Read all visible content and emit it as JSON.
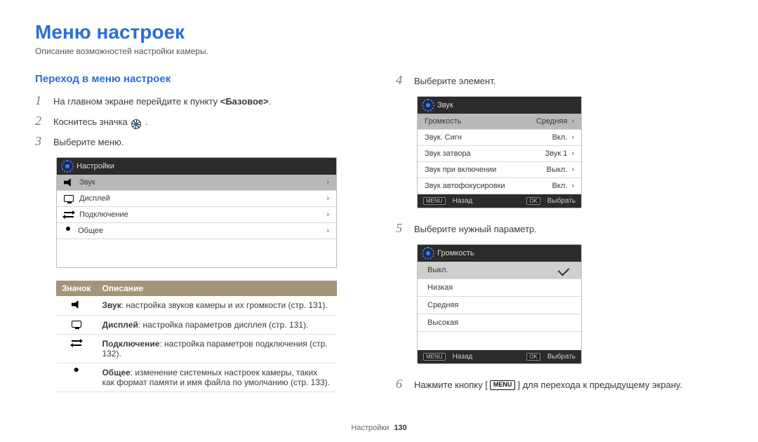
{
  "page": {
    "title": "Меню настроек",
    "subtitle": "Описание возможностей настройки камеры.",
    "footer_label": "Настройки",
    "footer_page": "130"
  },
  "section_heading": "Переход в меню настроек",
  "steps": {
    "s1_num": "1",
    "s1_pre": "На главном экране перейдите к пункту ",
    "s1_bold": "<Базовое>",
    "s1_post": ".",
    "s2_num": "2",
    "s2_pre": "Коснитесь значка",
    "s2_post": ".",
    "s3_num": "3",
    "s3_text": "Выберите меню.",
    "s4_num": "4",
    "s4_text": "Выберите элемент.",
    "s5_num": "5",
    "s5_text": "Выберите нужный параметр.",
    "s6_num": "6",
    "s6_pre": "Нажмите кнопку [",
    "s6_key": "MENU",
    "s6_post": "] для перехода к предыдущему экрану."
  },
  "settings_panel": {
    "header": "Настройки",
    "rows": [
      {
        "label": "Звук",
        "highlight": true
      },
      {
        "label": "Дисплей"
      },
      {
        "label": "Подключение"
      },
      {
        "label": "Общее"
      }
    ]
  },
  "desc_table": {
    "head_icon": "Значок",
    "head_desc": "Описание",
    "rows": [
      {
        "bold": "Звук",
        "text": ": настройка звуков камеры и их громкости (стр. 131)."
      },
      {
        "bold": "Дисплей",
        "text": ": настройка параметров дисплея (стр. 131)."
      },
      {
        "bold": "Подключение",
        "text": ": настройка параметров подключения (стр. 132)."
      },
      {
        "bold": "Общее",
        "text": ": изменение системных настроек камеры, таких как формат памяти и имя файла по умолчанию (стр. 133)."
      }
    ]
  },
  "sound_panel": {
    "header": "Звук",
    "rows": [
      {
        "label": "Громкость",
        "value": "Средняя",
        "highlight": true
      },
      {
        "label": "Звук. Сигн",
        "value": "Вкл."
      },
      {
        "label": "Звук затвора",
        "value": "Звук 1"
      },
      {
        "label": "Звук при включении",
        "value": "Выкл."
      },
      {
        "label": "Звук автофокусировки",
        "value": "Вкл."
      }
    ],
    "nav_back_key": "MENU",
    "nav_back": "Назад",
    "nav_ok_key": "OK",
    "nav_ok": "Выбрать"
  },
  "volume_panel": {
    "header": "Громкость",
    "options": [
      {
        "label": "Выкл.",
        "selected": true
      },
      {
        "label": "Низкая"
      },
      {
        "label": "Средняя"
      },
      {
        "label": "Высокая"
      }
    ],
    "nav_back_key": "MENU",
    "nav_back": "Назад",
    "nav_ok_key": "OK",
    "nav_ok": "Выбрать"
  }
}
